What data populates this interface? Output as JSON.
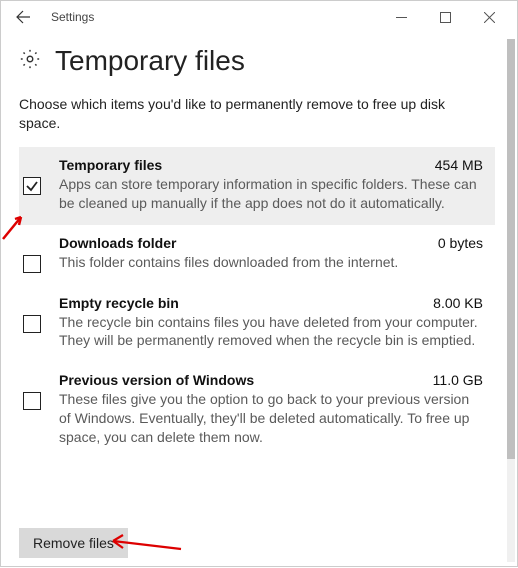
{
  "window": {
    "title": "Settings"
  },
  "page": {
    "heading": "Temporary files",
    "intro": "Choose which items you'd like to permanently remove to free up disk space."
  },
  "items": [
    {
      "title": "Temporary files",
      "size": "454 MB",
      "desc": "Apps can store temporary information in specific folders. These can be cleaned up manually if the app does not do it automatically.",
      "checked": true,
      "selected": true
    },
    {
      "title": "Downloads folder",
      "size": "0 bytes",
      "desc": "This folder contains files downloaded from the internet.",
      "checked": false,
      "selected": false
    },
    {
      "title": "Empty recycle bin",
      "size": "8.00 KB",
      "desc": "The recycle bin contains files you have deleted from your computer. They will be permanently removed when the recycle bin is emptied.",
      "checked": false,
      "selected": false
    },
    {
      "title": "Previous version of Windows",
      "size": "11.0 GB",
      "desc": "These files give you the option to go back to your previous version of Windows. Eventually, they'll be deleted automatically. To free up space, you can delete them now.",
      "checked": false,
      "selected": false
    }
  ],
  "actions": {
    "remove": "Remove files"
  }
}
